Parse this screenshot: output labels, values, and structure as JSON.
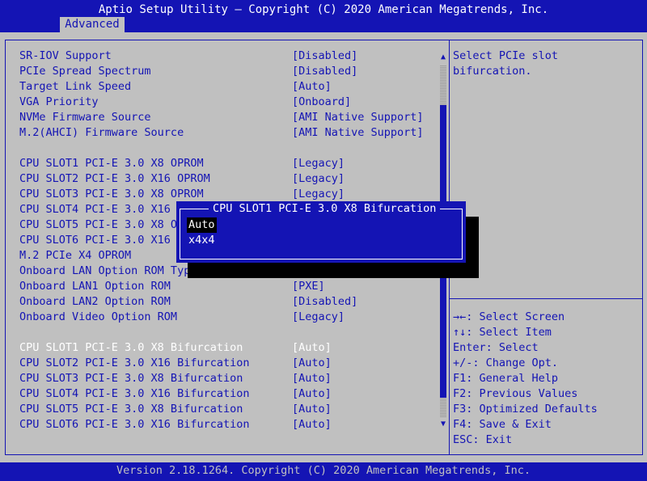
{
  "header": {
    "title": "Aptio Setup Utility – Copyright (C) 2020 American Megatrends, Inc.",
    "active_tab": "Advanced"
  },
  "settings": [
    {
      "label": "SR-IOV Support",
      "value": "[Disabled]"
    },
    {
      "label": "PCIe Spread Spectrum",
      "value": "[Disabled]"
    },
    {
      "label": "Target Link Speed",
      "value": "[Auto]"
    },
    {
      "label": "VGA Priority",
      "value": "[Onboard]"
    },
    {
      "label": "NVMe Firmware Source",
      "value": "[AMI Native Support]"
    },
    {
      "label": "M.2(AHCI) Firmware Source",
      "value": "[AMI Native Support]"
    },
    {
      "label": "CPU SLOT1 PCI-E 3.0 X8 OPROM",
      "value": "[Legacy]"
    },
    {
      "label": "CPU SLOT2 PCI-E 3.0 X16 OPROM",
      "value": "[Legacy]"
    },
    {
      "label": "CPU SLOT3 PCI-E 3.0 X8 OPROM",
      "value": "[Legacy]"
    },
    {
      "label": "CPU SLOT4 PCI-E 3.0 X16",
      "value": ""
    },
    {
      "label": "CPU SLOT5 PCI-E 3.0 X8 O",
      "value": ""
    },
    {
      "label": "CPU SLOT6 PCI-E 3.0 X16",
      "value": ""
    },
    {
      "label": "M.2 PCIe X4 OPROM",
      "value": ""
    },
    {
      "label": "Onboard LAN Option ROM Typ",
      "value": ""
    },
    {
      "label": "Onboard LAN1 Option ROM",
      "value": "[PXE]"
    },
    {
      "label": "Onboard LAN2 Option ROM",
      "value": "[Disabled]"
    },
    {
      "label": "Onboard Video Option ROM",
      "value": "[Legacy]"
    },
    {
      "label": "CPU SLOT1 PCI-E 3.0 X8 Bifurcation",
      "value": "[Auto]"
    },
    {
      "label": "CPU SLOT2 PCI-E 3.0 X16 Bifurcation",
      "value": "[Auto]"
    },
    {
      "label": "CPU SLOT3 PCI-E 3.0 X8 Bifurcation",
      "value": "[Auto]"
    },
    {
      "label": "CPU SLOT4 PCI-E 3.0 X16 Bifurcation",
      "value": "[Auto]"
    },
    {
      "label": "CPU SLOT5 PCI-E 3.0 X8 Bifurcation",
      "value": "[Auto]"
    },
    {
      "label": "CPU SLOT6 PCI-E 3.0 X16 Bifurcation",
      "value": "[Auto]"
    }
  ],
  "help_text": "Select PCIe slot\nbifurcation.",
  "keys": [
    "→←: Select Screen",
    "↑↓: Select Item",
    "Enter: Select",
    "+/-: Change Opt.",
    "F1: General Help",
    "F2: Previous Values",
    "F3: Optimized Defaults",
    "F4: Save & Exit",
    "ESC: Exit"
  ],
  "popup": {
    "title": "CPU SLOT1 PCI-E 3.0 X8 Bifurcation",
    "options": [
      "Auto",
      "x4x4"
    ],
    "selected": "Auto"
  },
  "scroll": {
    "up_icon": "up-arrow-icon",
    "down_icon": "down-arrow-icon"
  },
  "footer": {
    "text": "Version 2.18.1264. Copyright (C) 2020 American Megatrends, Inc."
  },
  "colors": {
    "blue": "#1414b4",
    "gray": "#c0c0c0",
    "white": "#ffffff",
    "black": "#000000"
  }
}
